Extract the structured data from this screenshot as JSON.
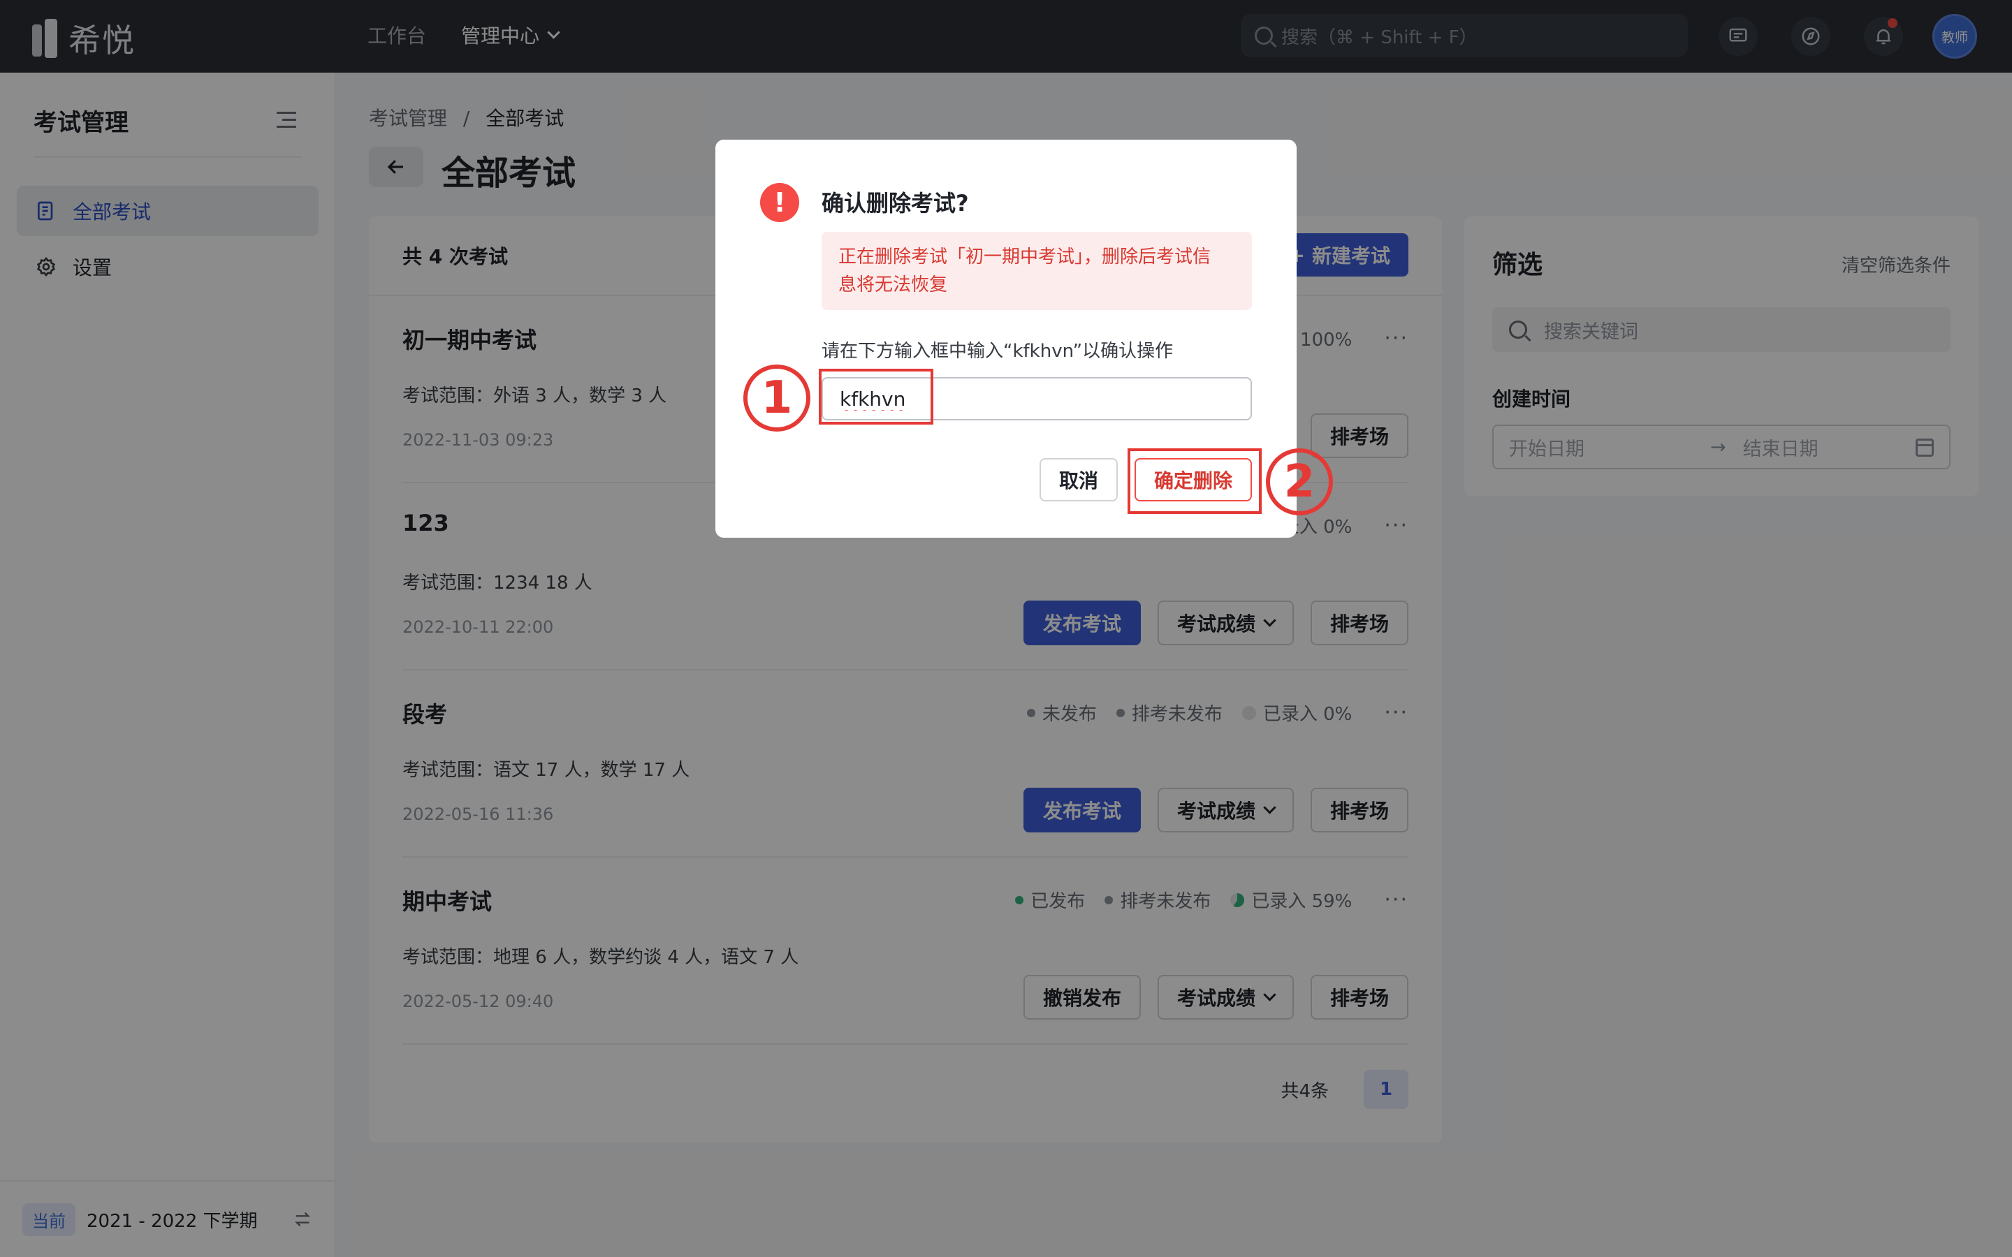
{
  "topbar": {
    "brand": "希悦",
    "nav": {
      "workbench": "工作台",
      "admin_center": "管理中心"
    },
    "search_placeholder": "搜索（⌘ + Shift + F）",
    "avatar_label": "教师"
  },
  "sidebar": {
    "title": "考试管理",
    "items": [
      {
        "label": "全部考试",
        "active": true
      },
      {
        "label": "设置",
        "active": false
      }
    ],
    "footer": {
      "tag": "当前",
      "term": "2021 - 2022 下学期"
    }
  },
  "breadcrumb": {
    "parent": "考试管理",
    "separator": "/",
    "current": "全部考试"
  },
  "page_title": "全部考试",
  "exam_list": {
    "count_label": "共 4 次考试",
    "new_button": "新建考试",
    "exams": [
      {
        "name": "初一期中考试",
        "scope": "考试范围：外语 3 人，数学 3 人",
        "date": "2022-11-03 09:23",
        "entered": "已录入 100%",
        "buttons": {
          "schedule": "排考场"
        }
      },
      {
        "name": "123",
        "scope": "考试范围：1234 18 人",
        "date": "2022-10-11 22:00",
        "entered": "已录入 0%",
        "buttons": {
          "publish": "发布考试",
          "scores": "考试成绩",
          "schedule": "排考场"
        }
      },
      {
        "name": "段考",
        "scope": "考试范围：语文 17 人，数学 17 人",
        "date": "2022-05-16 11:36",
        "status": "未发布",
        "seating": "排考未发布",
        "entered": "已录入 0%",
        "buttons": {
          "publish": "发布考试",
          "scores": "考试成绩",
          "schedule": "排考场"
        }
      },
      {
        "name": "期中考试",
        "scope": "考试范围：地理 6 人，数学约谈 4 人，语文 7 人",
        "date": "2022-05-12 09:40",
        "status": "已发布",
        "seating": "排考未发布",
        "entered": "已录入 59%",
        "entered_fraction": 0.59,
        "buttons": {
          "unpublish": "撤销发布",
          "scores": "考试成绩",
          "schedule": "排考场"
        }
      }
    ],
    "pager": {
      "total": "共4条",
      "page": "1"
    }
  },
  "filter": {
    "title": "筛选",
    "clear": "清空筛选条件",
    "search_placeholder": "搜索关键词",
    "created_label": "创建时间",
    "start_placeholder": "开始日期",
    "end_placeholder": "结束日期"
  },
  "modal": {
    "title": "确认删除考试?",
    "warning_line1": "正在删除考试「初一期中考试」，删除后考试信",
    "warning_line2": "息将无法恢复",
    "hint": "请在下方输入框中输入“kfkhvn”以确认操作",
    "input_value": "kfkhvn",
    "cancel": "取消",
    "confirm": "确定删除"
  },
  "annotations": {
    "step1": "1",
    "step2": "2"
  },
  "colors": {
    "primary": "#3e5fd9",
    "danger": "#f54a45",
    "annotation": "#e53935",
    "topbar": "#2b2f36"
  }
}
